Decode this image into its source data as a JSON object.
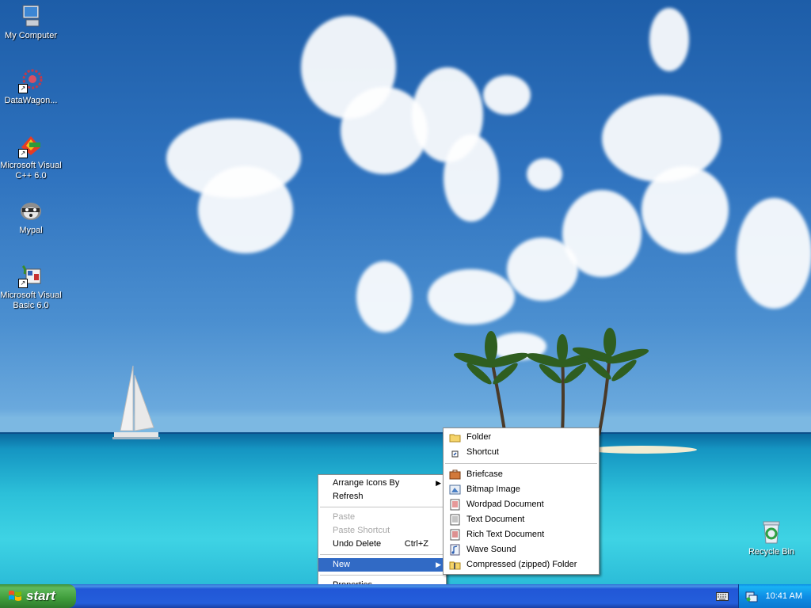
{
  "desktop": {
    "icons": [
      {
        "label": "My Computer",
        "icon": "my-computer-icon"
      },
      {
        "label": "DataWagon...",
        "icon": "datawagon-icon"
      },
      {
        "label": "Microsoft Visual C++ 6.0",
        "icon": "visual-cpp-icon"
      },
      {
        "label": "Mypal",
        "icon": "mypal-icon"
      },
      {
        "label": "Microsoft Visual Basic 6.0",
        "icon": "visual-basic-icon"
      },
      {
        "label": "Recycle Bin",
        "icon": "recycle-bin-icon"
      }
    ]
  },
  "context_menu": {
    "items": [
      {
        "label": "Arrange Icons By",
        "submenu": true
      },
      {
        "label": "Refresh"
      },
      {
        "label": "Paste",
        "disabled": true
      },
      {
        "label": "Paste Shortcut",
        "disabled": true
      },
      {
        "label": "Undo Delete",
        "accel": "Ctrl+Z"
      },
      {
        "label": "New",
        "submenu": true,
        "highlighted": true
      },
      {
        "label": "Properties"
      }
    ]
  },
  "new_submenu": {
    "items": [
      {
        "label": "Folder",
        "icon": "folder-icon"
      },
      {
        "label": "Shortcut",
        "icon": "shortcut-icon"
      },
      {
        "label": "Briefcase",
        "icon": "briefcase-icon"
      },
      {
        "label": "Bitmap Image",
        "icon": "bitmap-icon"
      },
      {
        "label": "Wordpad Document",
        "icon": "wordpad-icon"
      },
      {
        "label": "Text Document",
        "icon": "text-document-icon"
      },
      {
        "label": "Rich Text Document",
        "icon": "rich-text-icon"
      },
      {
        "label": "Wave Sound",
        "icon": "wave-sound-icon"
      },
      {
        "label": "Compressed (zipped) Folder",
        "icon": "zip-folder-icon"
      }
    ]
  },
  "taskbar": {
    "start_label": "start",
    "clock": "10:41 AM"
  },
  "colors": {
    "highlight": "#316ac5",
    "taskbar": "#245edb",
    "start_button": "#3f9c3b"
  }
}
